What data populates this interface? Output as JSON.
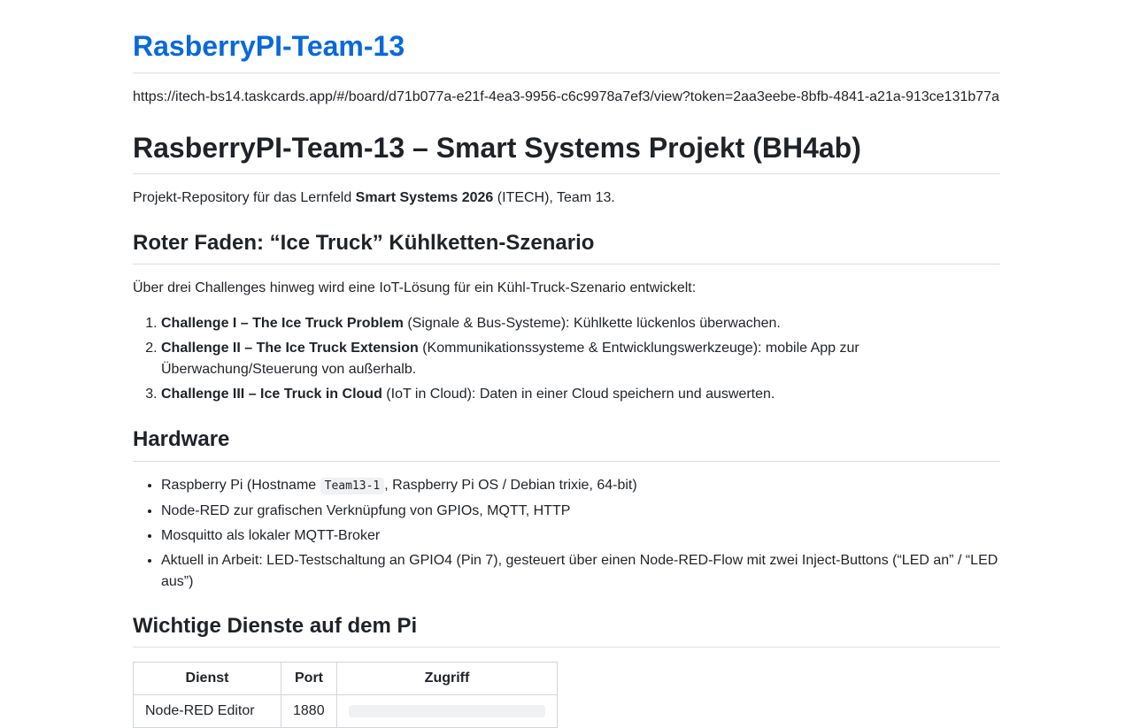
{
  "header": {
    "site_title": "RasberryPI-Team-13",
    "board_url": "https://itech-bs14.taskcards.app/#/board/d71b077a-e21f-4ea3-9956-c6c9978a7ef3/view?token=2aa3eebe-8bfb-4841-a21a-913ce131b77a"
  },
  "doc": {
    "title": "RasberryPI-Team-13 – Smart Systems Projekt (BH4ab)",
    "intro_before": "Projekt-Repository für das Lernfeld ",
    "intro_bold": "Smart Systems 2026",
    "intro_after": " (ITECH), Team 13."
  },
  "scenario": {
    "heading": "Roter Faden: “Ice Truck” Kühlketten-Szenario",
    "lead": "Über drei Challenges hinweg wird eine IoT-Lösung für ein Kühl-Truck-Szenario entwickelt:",
    "challenges": [
      {
        "bold": "Challenge I – The Ice Truck Problem",
        "rest": " (Signale & Bus-Systeme): Kühlkette lückenlos überwachen."
      },
      {
        "bold": "Challenge II – The Ice Truck Extension",
        "rest": " (Kommunikationssysteme & Entwicklungswerkzeuge): mobile App zur Überwachung/Steuerung von außerhalb."
      },
      {
        "bold": "Challenge III – Ice Truck in Cloud",
        "rest": " (IoT in Cloud): Daten in einer Cloud speichern und auswerten."
      }
    ]
  },
  "hardware": {
    "heading": "Hardware",
    "items": [
      {
        "before": "Raspberry Pi (Hostname ",
        "code": "Team13-1",
        "after": ", Raspberry Pi OS / Debian trixie, 64-bit)"
      },
      {
        "text": "Node-RED zur grafischen Verknüpfung von GPIOs, MQTT, HTTP"
      },
      {
        "text": "Mosquitto als lokaler MQTT-Broker"
      },
      {
        "text": "Aktuell in Arbeit: LED-Testschaltung an GPIO4 (Pin 7), gesteuert über einen Node-RED-Flow mit zwei Inject-Buttons (“LED an” / “LED aus”)"
      }
    ]
  },
  "services": {
    "heading": "Wichtige Dienste auf dem Pi",
    "columns": [
      "Dienst",
      "Port",
      "Zugriff"
    ],
    "rows": [
      {
        "dienst": "Node-RED Editor",
        "port": "1880"
      }
    ]
  }
}
